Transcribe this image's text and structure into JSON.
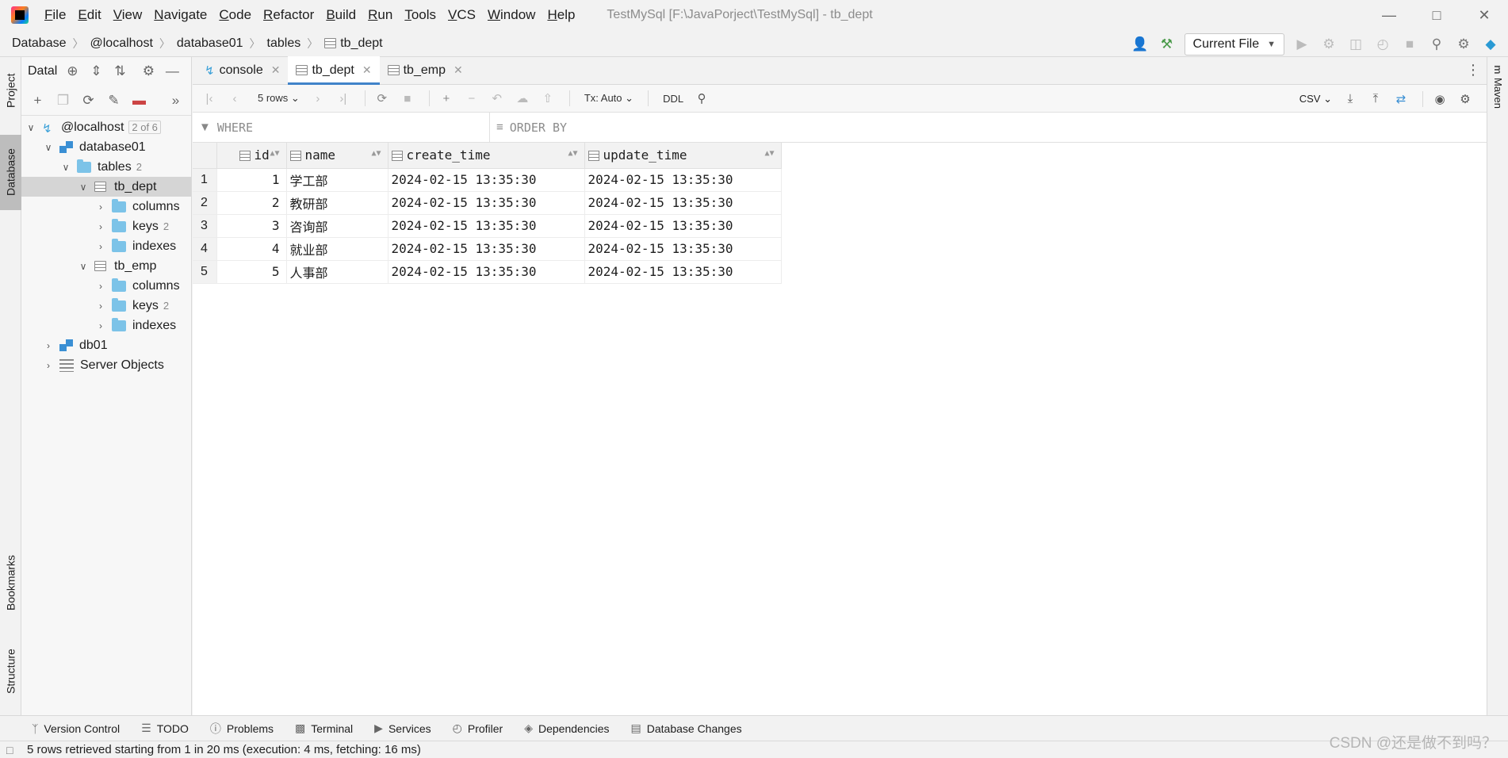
{
  "titlebar": {
    "menus": [
      "File",
      "Edit",
      "View",
      "Navigate",
      "Code",
      "Refactor",
      "Build",
      "Run",
      "Tools",
      "VCS",
      "Window",
      "Help"
    ],
    "window_title": "TestMySql [F:\\JavaPorject\\TestMySql] - tb_dept"
  },
  "navbar": {
    "breadcrumb": [
      "Database",
      "@localhost",
      "database01",
      "tables",
      "tb_dept"
    ],
    "run_config": "Current File"
  },
  "left_strip": {
    "project": "Project",
    "database": "Database",
    "bookmarks": "Bookmarks",
    "structure": "Structure"
  },
  "right_strip": {
    "maven": "Maven",
    "maven_glyph": "m"
  },
  "db_panel": {
    "title": "Datal",
    "tree": {
      "host": "@localhost",
      "host_count": "2 of 6",
      "database01": "database01",
      "tables": "tables",
      "tables_count": "2",
      "tb_dept": "tb_dept",
      "dept_columns": "columns",
      "dept_keys": "keys",
      "dept_keys_count": "2",
      "dept_indexes": "indexes",
      "tb_emp": "tb_emp",
      "emp_columns": "columns",
      "emp_keys": "keys",
      "emp_keys_count": "2",
      "emp_indexes": "indexes",
      "db01": "db01",
      "server_objects": "Server Objects"
    }
  },
  "editor": {
    "tabs": [
      "console",
      "tb_dept",
      "tb_emp"
    ],
    "toolbar": {
      "rows": "5 rows",
      "tx": "Tx: Auto",
      "ddl": "DDL",
      "export_format": "CSV"
    },
    "filter": {
      "where": "WHERE",
      "order_by": "ORDER BY"
    },
    "grid": {
      "columns": [
        "id",
        "name",
        "create_time",
        "update_time"
      ],
      "rows": [
        [
          "1",
          "1",
          "学工部",
          "2024-02-15 13:35:30",
          "2024-02-15 13:35:30"
        ],
        [
          "2",
          "2",
          "教研部",
          "2024-02-15 13:35:30",
          "2024-02-15 13:35:30"
        ],
        [
          "3",
          "3",
          "咨询部",
          "2024-02-15 13:35:30",
          "2024-02-15 13:35:30"
        ],
        [
          "4",
          "4",
          "就业部",
          "2024-02-15 13:35:30",
          "2024-02-15 13:35:30"
        ],
        [
          "5",
          "5",
          "人事部",
          "2024-02-15 13:35:30",
          "2024-02-15 13:35:30"
        ]
      ]
    }
  },
  "bottom_bar": [
    "Version Control",
    "TODO",
    "Problems",
    "Terminal",
    "Services",
    "Profiler",
    "Dependencies",
    "Database Changes"
  ],
  "status": "5 rows retrieved starting from 1 in 20 ms (execution: 4 ms, fetching: 16 ms)",
  "watermark": "CSDN @还是做不到吗？"
}
